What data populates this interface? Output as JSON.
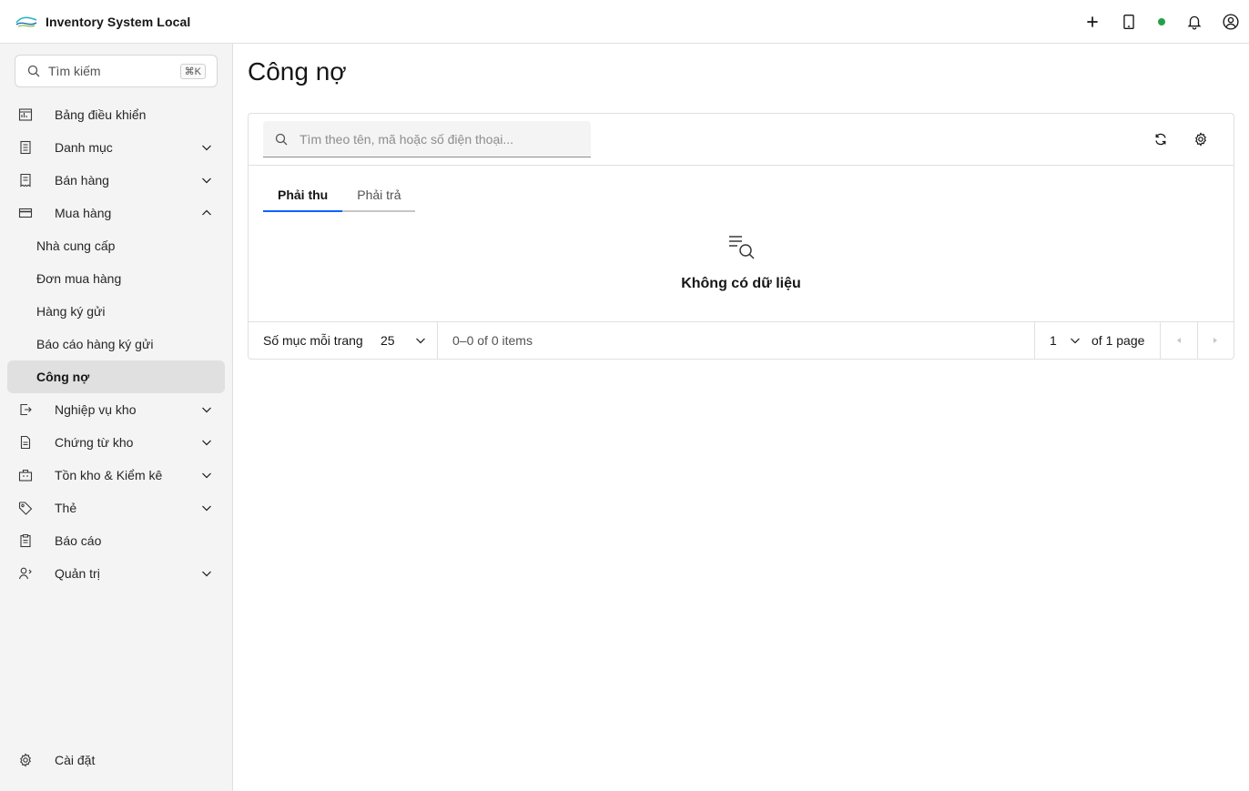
{
  "header": {
    "app_title": "Inventory System Local",
    "logo_icon": "brand-logo",
    "status_color": "#24a148"
  },
  "sidebar": {
    "search_placeholder": "Tìm kiếm",
    "search_shortcut": "⌘K",
    "items": [
      {
        "label": "Bảng điều khiển",
        "icon": "dashboard-icon",
        "expandable": false
      },
      {
        "label": "Danh mục",
        "icon": "catalog-icon",
        "expandable": true,
        "expanded": false
      },
      {
        "label": "Bán hàng",
        "icon": "receipt-icon",
        "expandable": true,
        "expanded": false
      },
      {
        "label": "Mua hàng",
        "icon": "card-icon",
        "expandable": true,
        "expanded": true,
        "children": [
          "Nhà cung cấp",
          "Đơn mua hàng",
          "Hàng ký gửi",
          "Báo cáo hàng ký gửi",
          "Công nợ"
        ]
      },
      {
        "label": "Nghiệp vụ kho",
        "icon": "transfer-icon",
        "expandable": true,
        "expanded": false
      },
      {
        "label": "Chứng từ kho",
        "icon": "document-icon",
        "expandable": true,
        "expanded": false
      },
      {
        "label": "Tồn kho & Kiểm kê",
        "icon": "inventory-icon",
        "expandable": true,
        "expanded": false
      },
      {
        "label": "Thẻ",
        "icon": "tag-icon",
        "expandable": true,
        "expanded": false
      },
      {
        "label": "Báo cáo",
        "icon": "report-icon",
        "expandable": false
      },
      {
        "label": "Quản trị",
        "icon": "admin-icon",
        "expandable": true,
        "expanded": false
      }
    ],
    "active_child": "Công nợ",
    "settings_label": "Cài đặt"
  },
  "main": {
    "page_title": "Công nợ",
    "search_placeholder": "Tìm theo tên, mã hoặc số điện thoại...",
    "tabs": [
      {
        "label": "Phải thu",
        "active": true
      },
      {
        "label": "Phải trả",
        "active": false
      }
    ],
    "empty_text": "Không có dữ liệu",
    "pagination": {
      "per_page_label": "Số mục mỗi trang",
      "per_page_value": "25",
      "range_text": "0–0 of 0 items",
      "page_value": "1",
      "page_total_text": "of 1 page"
    }
  },
  "colors": {
    "accent": "#0f62fe",
    "sidebar_bg": "#f4f4f4",
    "active_item_bg": "#e0e0e0"
  }
}
